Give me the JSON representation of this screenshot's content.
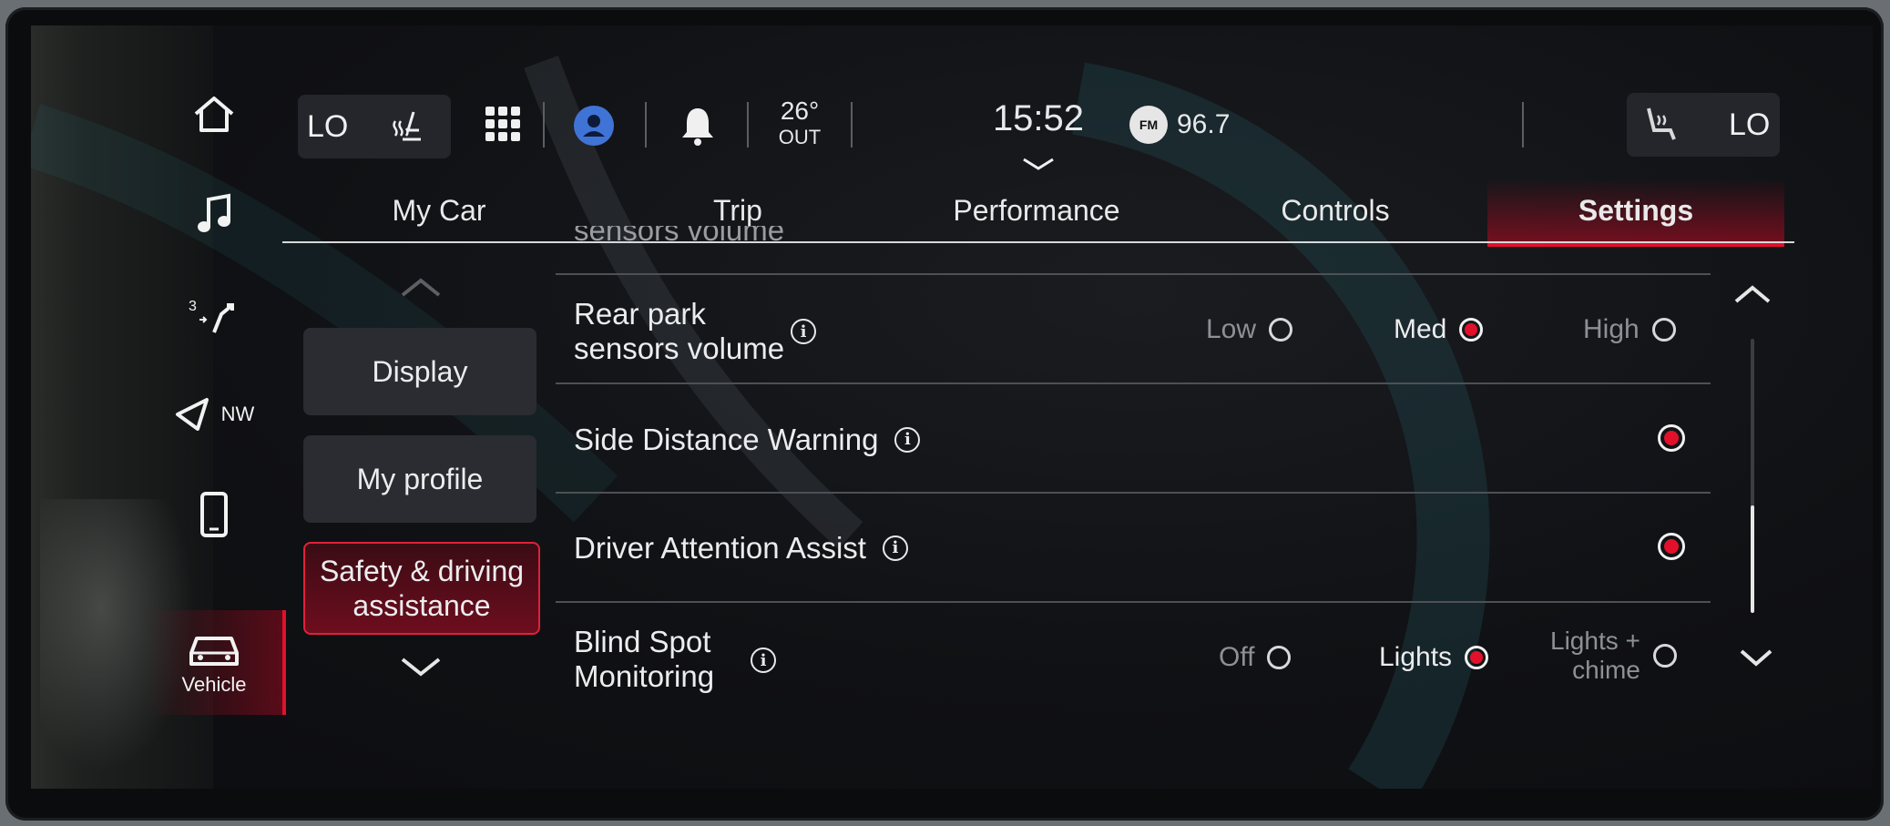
{
  "status_bar": {
    "left_temp": "LO",
    "right_temp": "LO",
    "outside_temp": "26°",
    "outside_label": "OUT",
    "clock": "15:52",
    "radio_band": "FM",
    "radio_freq": "96.7"
  },
  "left_nav": {
    "items": [
      {
        "icon": "home-icon"
      },
      {
        "icon": "music-icon"
      },
      {
        "icon": "turn-icon",
        "label": "3"
      },
      {
        "icon": "navigation-icon",
        "label": "NW"
      },
      {
        "icon": "phone-icon"
      },
      {
        "icon": "car-icon",
        "label": "Vehicle",
        "active": true
      }
    ]
  },
  "tabs": [
    {
      "label": "My Car"
    },
    {
      "label": "Trip"
    },
    {
      "label": "Performance"
    },
    {
      "label": "Controls"
    },
    {
      "label": "Settings",
      "active": true
    }
  ],
  "categories": [
    {
      "label": "Display"
    },
    {
      "label": "My profile"
    },
    {
      "label": "Safety & driving assistance",
      "active": true
    }
  ],
  "settings": {
    "partial_row_label": "sensors volume",
    "rear_park": {
      "label_line1": "Rear park",
      "label_line2": "sensors volume",
      "options": [
        "Low",
        "Med",
        "High"
      ],
      "selected": "Med"
    },
    "side_distance": {
      "label": "Side Distance Warning",
      "enabled": true
    },
    "driver_attention": {
      "label": "Driver Attention Assist",
      "enabled": true
    },
    "blind_spot": {
      "label_line1": "Blind Spot",
      "label_line2": "Monitoring",
      "options": [
        "Off",
        "Lights",
        "Lights +",
        "chime"
      ],
      "selected": "Lights"
    }
  },
  "colors": {
    "accent": "#e3102b",
    "background": "#101114"
  }
}
